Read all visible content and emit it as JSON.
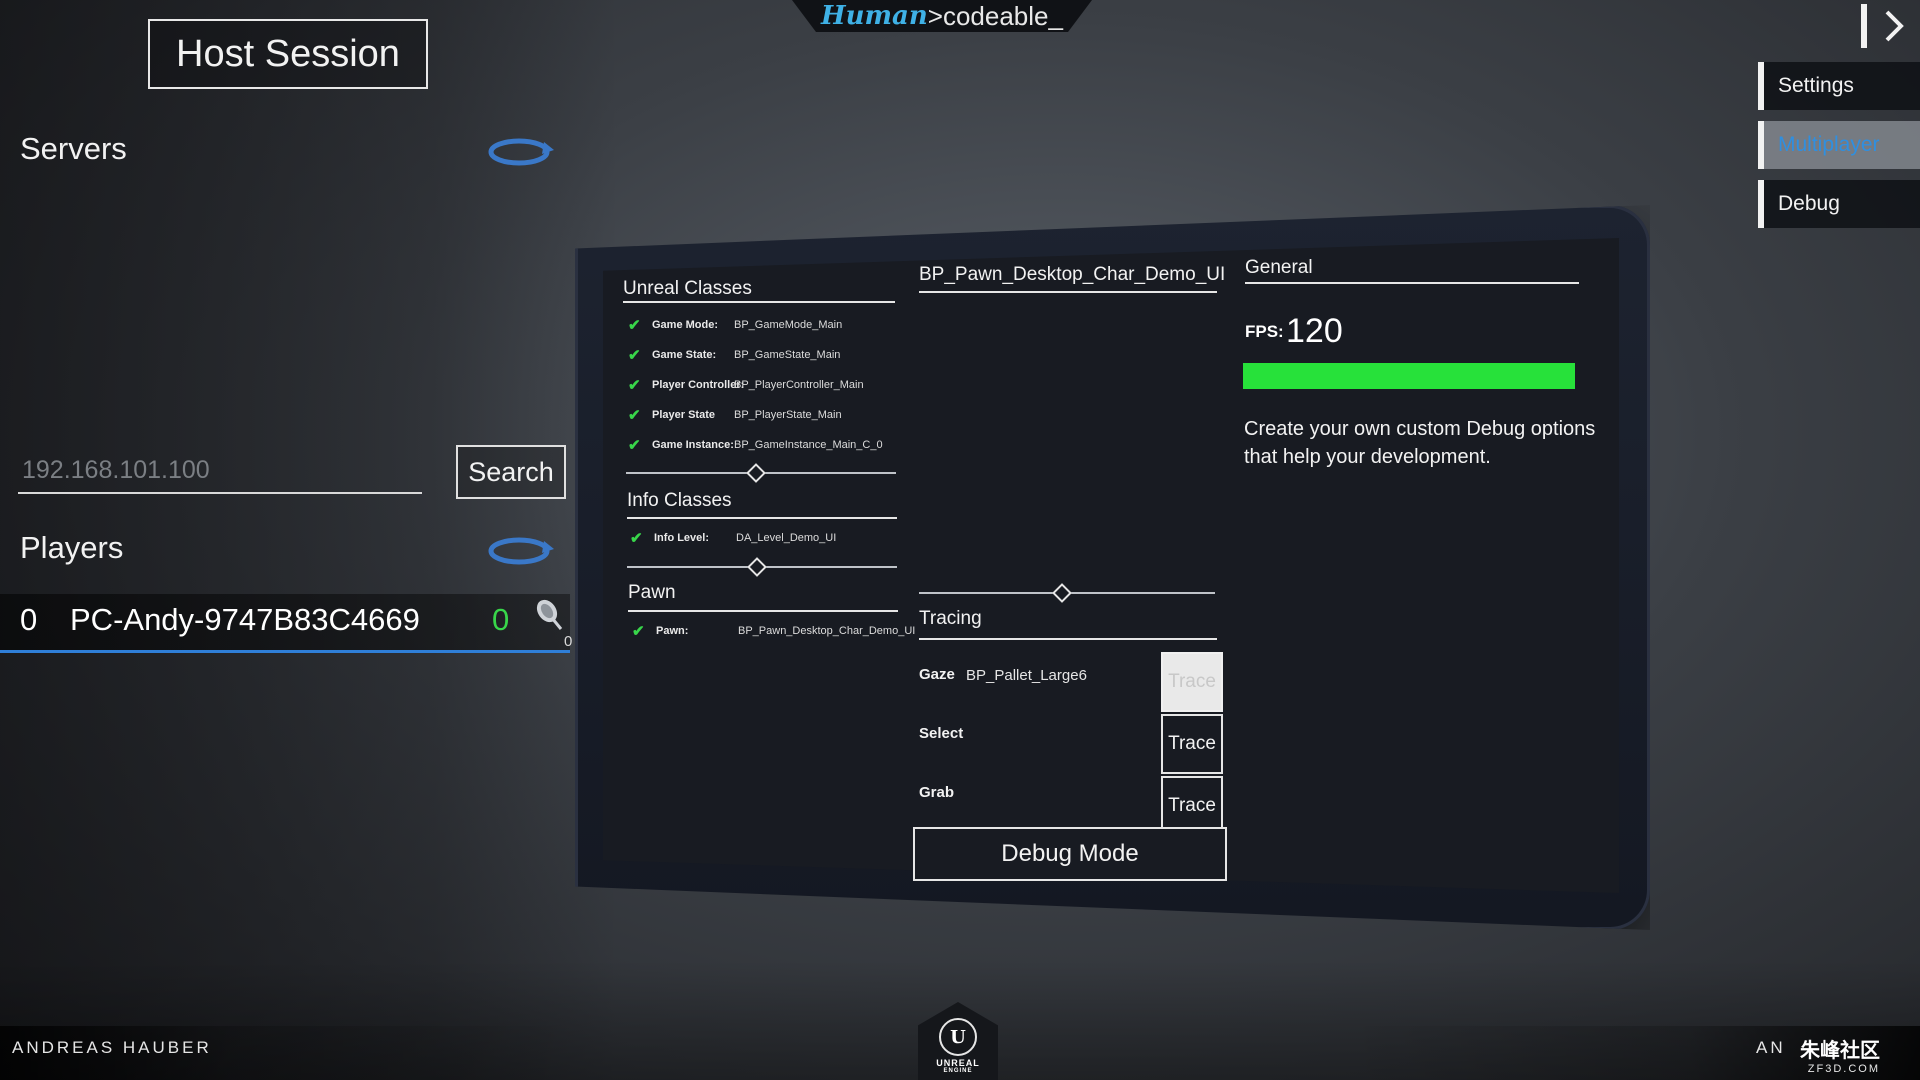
{
  "logo": {
    "human": "Human",
    "rest": ">codeable_"
  },
  "left_panel": {
    "host_button": "Host Session",
    "servers_title": "Servers",
    "ip_placeholder": "192.168.101.100",
    "search_button": "Search",
    "players_title": "Players",
    "players": [
      {
        "index": "0",
        "name": "PC-Andy-9747B83C4669",
        "ping": "0",
        "mic_count": "0"
      }
    ]
  },
  "nav": {
    "items": [
      {
        "label": "Settings",
        "active": false
      },
      {
        "label": "Multiplayer",
        "active": true
      },
      {
        "label": "Debug",
        "active": false
      }
    ]
  },
  "monitor": {
    "unreal_classes": {
      "title": "Unreal Classes",
      "rows": [
        {
          "label": "Game Mode:",
          "value": "BP_GameMode_Main"
        },
        {
          "label": "Game State:",
          "value": "BP_GameState_Main"
        },
        {
          "label": "Player Controller:",
          "value": "BP_PlayerController_Main"
        },
        {
          "label": "Player State",
          "value": "BP_PlayerState_Main"
        },
        {
          "label": "Game Instance:",
          "value": "BP_GameInstance_Main_C_0"
        }
      ]
    },
    "info_classes": {
      "title": "Info Classes",
      "rows": [
        {
          "label": "Info Level:",
          "value": "DA_Level_Demo_UI"
        }
      ]
    },
    "pawn": {
      "title": "Pawn",
      "rows": [
        {
          "label": "Pawn:",
          "value": "BP_Pawn_Desktop_Char_Demo_UI"
        }
      ]
    },
    "pawn_title": "BP_Pawn_Desktop_Char_Demo_UI",
    "tracing": {
      "title": "Tracing",
      "rows": [
        {
          "label": "Gaze",
          "value": "BP_Pallet_Large6",
          "button": "Trace",
          "disabled": true
        },
        {
          "label": "Select",
          "value": "",
          "button": "Trace",
          "disabled": false
        },
        {
          "label": "Grab",
          "value": "",
          "button": "Trace",
          "disabled": false
        }
      ],
      "debug_button": "Debug Mode"
    },
    "general": {
      "title": "General",
      "fps_label": "FPS:",
      "fps_value": "120",
      "fps_bar_fraction": 1.0,
      "description": "Create your own custom Debug options that help your development."
    }
  },
  "footer": {
    "author_left": "ANDREAS HAUBER",
    "author_right": "AN",
    "engine_logo_text": "UNREAL",
    "engine_logo_subtext": "ENGINE",
    "watermark": "朱峰社区",
    "watermark_sub": "ZF3D.COM"
  },
  "colors": {
    "accent_blue": "#2f7fd8",
    "ok_green": "#38d64a",
    "fps_green": "#27e13a",
    "logo_blue": "#3fb1e6"
  },
  "icons": {
    "refresh": "refresh-icon",
    "mic": "mic-icon",
    "check": "checkmark-icon",
    "nav_toggle": "chevron-right-icon"
  }
}
